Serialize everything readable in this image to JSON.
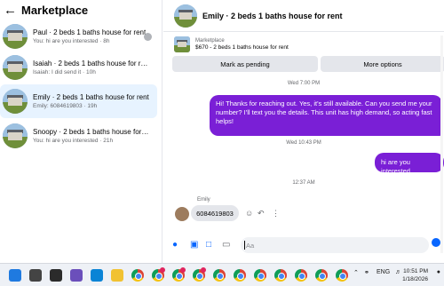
{
  "marketplace": {
    "back_icon": "back-arrow-icon",
    "title": "Marketplace",
    "conversations": [
      {
        "name": "Paul · 2 beds 1 baths house for rent",
        "preview": "You: hi are you interested · 8h",
        "active": false
      },
      {
        "name": "Isaiah · 2 beds 1 baths house for re...",
        "preview": "Isaiah: I did send it · 10h",
        "active": false
      },
      {
        "name": "Emily · 2 beds 1 baths house for rent",
        "preview": "Emily: 6084619803 · 19h",
        "active": true
      },
      {
        "name": "Snoopy · 2 beds 1 baths house for rent",
        "preview": "You: hi are you interested · 21h",
        "active": false
      }
    ]
  },
  "chat": {
    "title": "Emily · 2 beds 1 baths house for rent",
    "listing_source": "Marketplace",
    "listing_desc": "$670 - 2 beds 1 baths house for rent",
    "mark_pending_label": "Mark as pending",
    "more_options_label": "More options",
    "timestamps": [
      "Wed 7:00 PM",
      "Wed 10:43 PM",
      "12:37 AM"
    ],
    "messages_out": [
      "Hi! Thanks for reaching out. Yes, it's still available. Can you send me your number? I'll text you the details. This unit has high demand, so acting fast helps!",
      "hi are you interested"
    ],
    "incoming_sender": "Emily",
    "incoming_message": "6084619803",
    "composer_placeholder": "Aa"
  },
  "taskbar": {
    "language": "ENG",
    "time": "10:51 PM",
    "date": "1/18/2026"
  },
  "colors": {
    "accent": "#0866ff",
    "outgoing_bubble": "#7a1fd6",
    "active_conversation": "#e7f3ff",
    "button_bg": "#e4e6eb"
  }
}
